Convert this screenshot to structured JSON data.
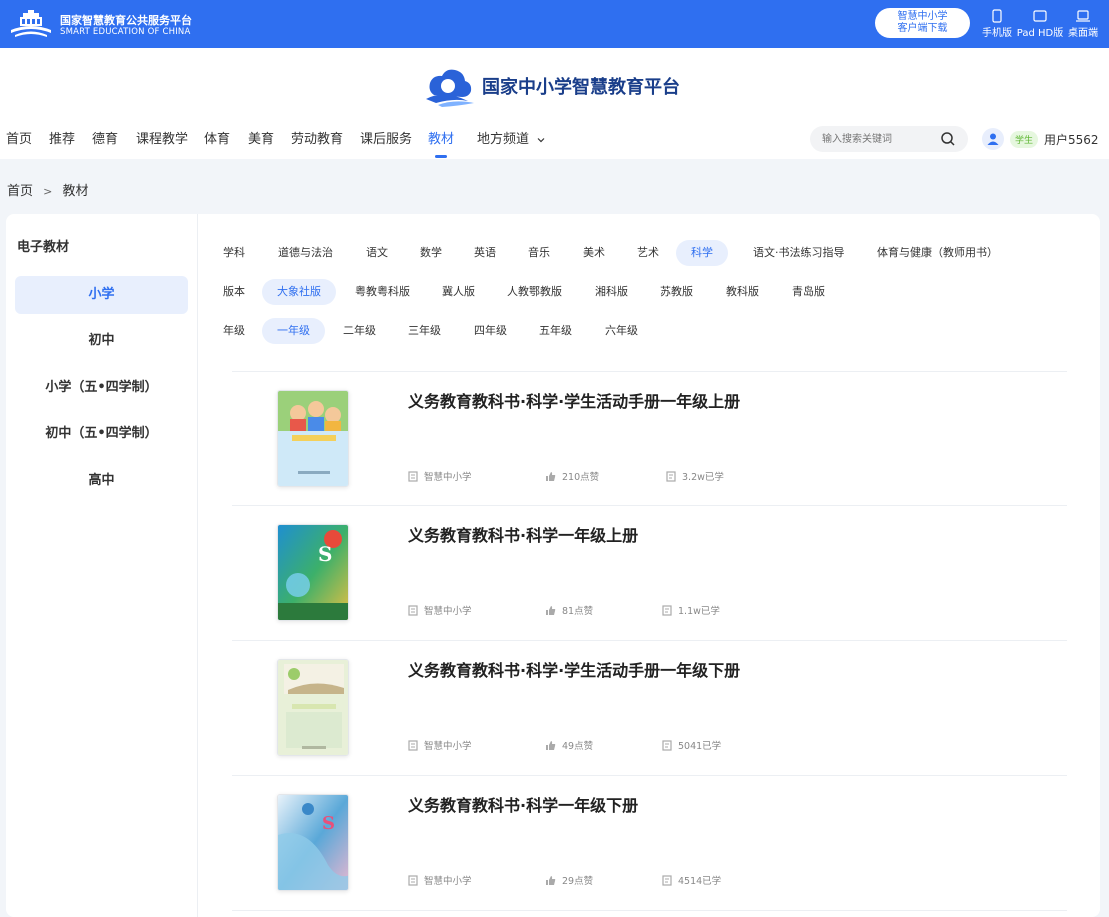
{
  "topbar": {
    "logo_cn": "国家智慧教育公共服务平台",
    "logo_en": "SMART EDUCATION OF CHINA",
    "download_line1": "智慧中小学",
    "download_line2": "客户端下载",
    "devices": [
      "手机版",
      "Pad HD版",
      "桌面端"
    ],
    "bg_color": "#2f6ff0"
  },
  "header": {
    "brand_name": "国家中小学智慧教育平台",
    "nav": [
      "首页",
      "推荐",
      "德育",
      "课程教学",
      "体育",
      "美育",
      "劳动教育",
      "课后服务",
      "教材",
      "地方频道"
    ],
    "nav_active": "教材",
    "search_placeholder": "输入搜索关键词",
    "role_badge": "学生",
    "username": "用户5562"
  },
  "breadcrumb": {
    "home": "首页",
    "separator": ">",
    "current": "教材"
  },
  "sidebar": {
    "title": "电子教材",
    "items": [
      "小学",
      "初中",
      "小学（五•四学制）",
      "初中（五•四学制）",
      "高中"
    ],
    "active": "小学"
  },
  "filters": {
    "subject": {
      "label": "学科",
      "options": [
        "道德与法治",
        "语文",
        "数学",
        "英语",
        "音乐",
        "美术",
        "艺术",
        "科学",
        "语文·书法练习指导",
        "体育与健康（教师用书）"
      ],
      "active": "科学"
    },
    "edition": {
      "label": "版本",
      "options": [
        "大象社版",
        "粤教粤科版",
        "冀人版",
        "人教鄂教版",
        "湘科版",
        "苏教版",
        "教科版",
        "青岛版"
      ],
      "active": "大象社版"
    },
    "grade": {
      "label": "年级",
      "options": [
        "一年级",
        "二年级",
        "三年级",
        "四年级",
        "五年级",
        "六年级"
      ],
      "active": "一年级"
    }
  },
  "books": [
    {
      "title": "义务教育教科书·科学·学生活动手册一年级上册",
      "publisher": "智慧中小学",
      "likes": "210点赞",
      "learners": "3.2w已学",
      "cover_style": "workbook-kids"
    },
    {
      "title": "义务教育教科书·科学一年级上册",
      "publisher": "智慧中小学",
      "likes": "81点赞",
      "learners": "1.1w已学",
      "cover_style": "science-green"
    },
    {
      "title": "义务教育教科书·科学·学生活动手册一年级下册",
      "publisher": "智慧中小学",
      "likes": "49点赞",
      "learners": "5041已学",
      "cover_style": "workbook-plain"
    },
    {
      "title": "义务教育教科书·科学一年级下册",
      "publisher": "智慧中小学",
      "likes": "29点赞",
      "learners": "4514已学",
      "cover_style": "science-water"
    }
  ]
}
